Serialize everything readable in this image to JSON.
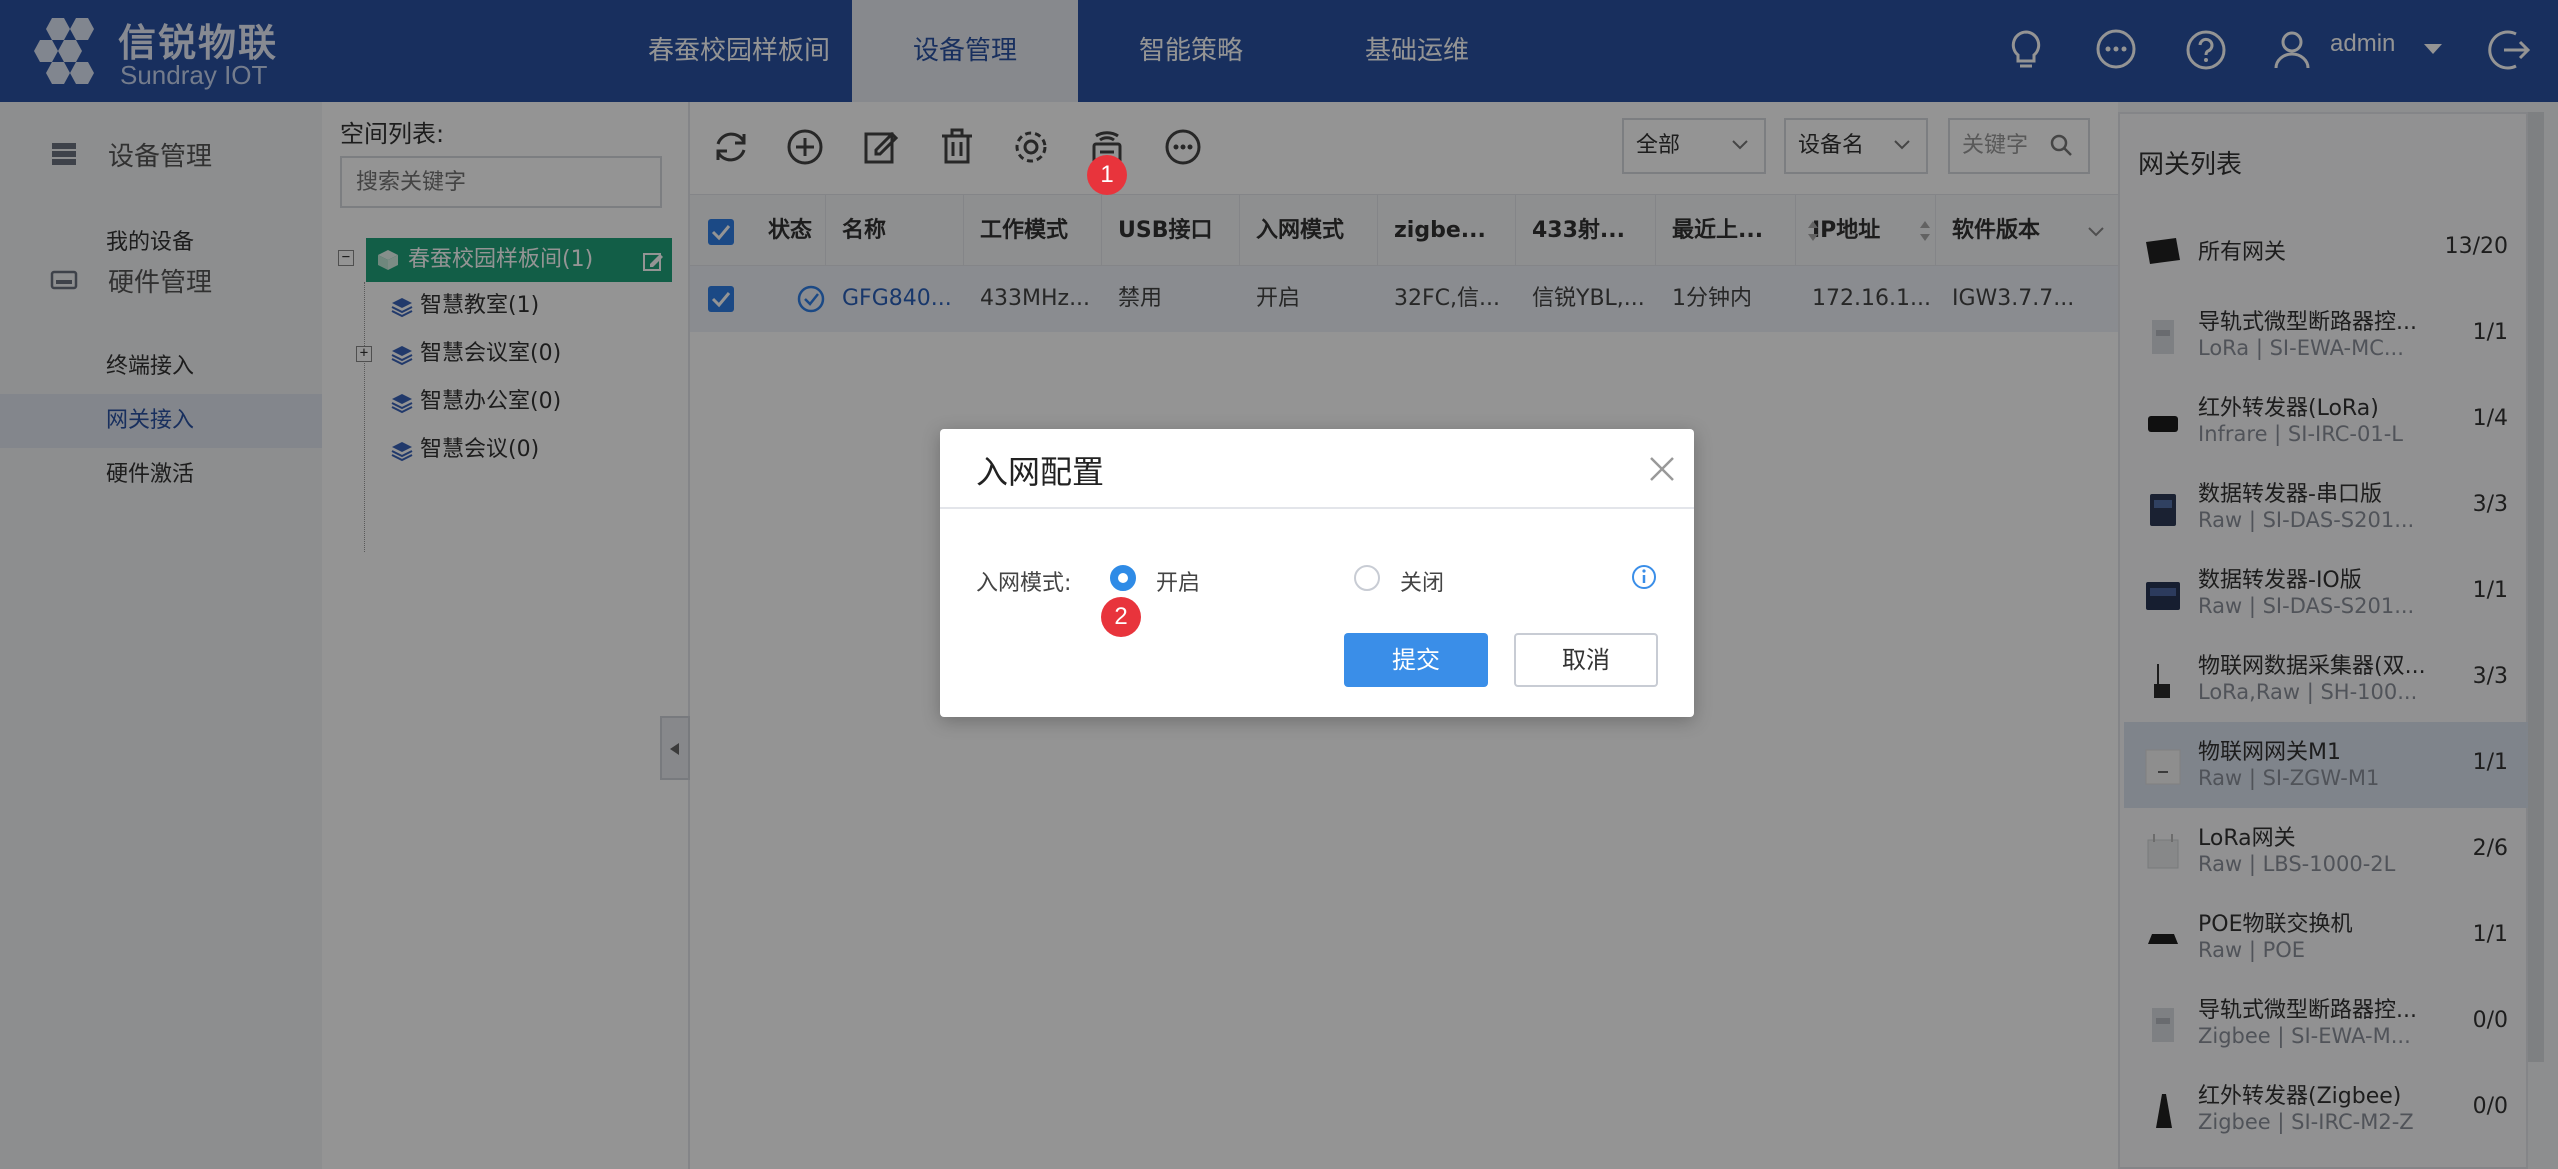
{
  "brand": {
    "title": "信锐物联",
    "subtitle": "Sundray IOT"
  },
  "nav": {
    "tabs": [
      {
        "label": "春蚕校园样板间"
      },
      {
        "label": "设备管理",
        "active": true
      },
      {
        "label": "智能策略"
      },
      {
        "label": "基础运维"
      }
    ],
    "icons": [
      "bulb-icon",
      "chat-icon",
      "help-icon",
      "user-icon",
      "logout-icon"
    ],
    "user": "admin"
  },
  "sidebar": {
    "groups": [
      {
        "label": "设备管理",
        "icon": "device-stack-icon",
        "items": [
          {
            "label": "我的设备"
          }
        ]
      },
      {
        "label": "硬件管理",
        "icon": "hardware-icon",
        "items": [
          {
            "label": "终端接入"
          },
          {
            "label": "网关接入",
            "active": true
          },
          {
            "label": "硬件激活"
          }
        ]
      }
    ]
  },
  "tree": {
    "title": "空间列表:",
    "search_placeholder": "搜索关键字",
    "root": "春蚕校园样板间(1)",
    "nodes": [
      {
        "label": "智慧教室(1)"
      },
      {
        "label": "智慧会议室(0)",
        "expandable": true
      },
      {
        "label": "智慧办公室(0)"
      },
      {
        "label": "智慧会议(0)"
      }
    ]
  },
  "toolbar": {
    "icons": [
      "refresh-icon",
      "add-icon",
      "edit-icon",
      "delete-icon",
      "settings-icon",
      "gateway-network-icon",
      "more-icon"
    ],
    "filter_all": "全部",
    "filter_field": "设备名",
    "keyword_placeholder": "关键字"
  },
  "table": {
    "headers": [
      "状态",
      "名称",
      "工作模式",
      "USB接口",
      "入网模式",
      "zigbe...",
      "433射...",
      "最近上...",
      "IP地址",
      "软件版本"
    ],
    "rows": [
      {
        "status": "online",
        "cells": [
          "GFG840...",
          "433MHz...",
          "禁用",
          "开启",
          "32FC,信...",
          "信锐YBL,...",
          "1分钟内",
          "172.16.1...",
          "IGW3.7.7..."
        ]
      }
    ]
  },
  "gateways": {
    "title": "网关列表",
    "items": [
      {
        "name": "所有网关",
        "sub": "",
        "count": "13/20"
      },
      {
        "name": "导轨式微型断路器控...",
        "sub": "LoRa | SI-EWA-MC...",
        "count": "1/1"
      },
      {
        "name": "红外转发器(LoRa)",
        "sub": "Infrare | SI-IRC-01-L",
        "count": "1/4"
      },
      {
        "name": "数据转发器-串口版",
        "sub": "Raw | SI-DAS-S201...",
        "count": "3/3"
      },
      {
        "name": "数据转发器-IO版",
        "sub": "Raw | SI-DAS-S201...",
        "count": "1/1"
      },
      {
        "name": "物联网数据采集器(双...",
        "sub": "LoRa,Raw | SH-100...",
        "count": "3/3"
      },
      {
        "name": "物联网网关M1",
        "sub": "Raw | SI-ZGW-M1",
        "count": "1/1",
        "selected": true
      },
      {
        "name": "LoRa网关",
        "sub": "Raw | LBS-1000-2L",
        "count": "2/6"
      },
      {
        "name": "POE物联交换机",
        "sub": "Raw | POE",
        "count": "1/1"
      },
      {
        "name": "导轨式微型断路器控...",
        "sub": "Zigbee | SI-EWA-M...",
        "count": "0/0"
      },
      {
        "name": "红外转发器(Zigbee)",
        "sub": "Zigbee | SI-IRC-M2-Z",
        "count": "0/0"
      }
    ]
  },
  "modal": {
    "title": "入网配置",
    "label": "入网模式:",
    "options": [
      {
        "label": "开启",
        "selected": true
      },
      {
        "label": "关闭",
        "selected": false
      }
    ],
    "submit": "提交",
    "cancel": "取消"
  },
  "markers": [
    "1",
    "2"
  ],
  "colors": {
    "header": "#2a52a3",
    "accent": "#3a8ee8",
    "tree_root": "#1fa37a",
    "marker": "#e8343c"
  }
}
